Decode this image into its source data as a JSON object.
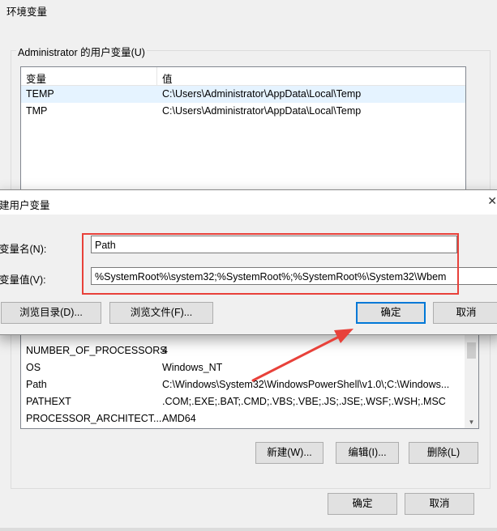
{
  "window": {
    "title": "环境变量"
  },
  "user_vars": {
    "group_label": "Administrator 的用户变量(U)",
    "headers": [
      "变量",
      "值"
    ],
    "rows": [
      {
        "name": "TEMP",
        "value": "C:\\Users\\Administrator\\AppData\\Local\\Temp"
      },
      {
        "name": "TMP",
        "value": "C:\\Users\\Administrator\\AppData\\Local\\Temp"
      }
    ]
  },
  "system_vars": {
    "rows": [
      {
        "name": "NUMBER_OF_PROCESSORS",
        "value": "4"
      },
      {
        "name": "OS",
        "value": "Windows_NT"
      },
      {
        "name": "Path",
        "value": "C:\\Windows\\System32\\WindowsPowerShell\\v1.0\\;C:\\Windows..."
      },
      {
        "name": "PATHEXT",
        "value": ".COM;.EXE;.BAT;.CMD;.VBS;.VBE;.JS;.JSE;.WSF;.WSH;.MSC"
      },
      {
        "name": "PROCESSOR_ARCHITECT...",
        "value": "AMD64"
      }
    ],
    "buttons": {
      "new": "新建(W)...",
      "edit": "编辑(I)...",
      "delete": "删除(L)"
    }
  },
  "footer": {
    "ok": "确定",
    "cancel": "取消"
  },
  "dialog": {
    "title": "建用户变量",
    "name_label": "变量名(N):",
    "value_label": "变量值(V):",
    "name_value": "Path",
    "value_value": "%SystemRoot%\\system32;%SystemRoot%;%SystemRoot%\\System32\\Wbem",
    "browse_dir": "浏览目录(D)...",
    "browse_file": "浏览文件(F)...",
    "ok": "确定",
    "cancel": "取消"
  },
  "colors": {
    "annotation": "#e8413a",
    "selection": "#e5f3ff"
  }
}
